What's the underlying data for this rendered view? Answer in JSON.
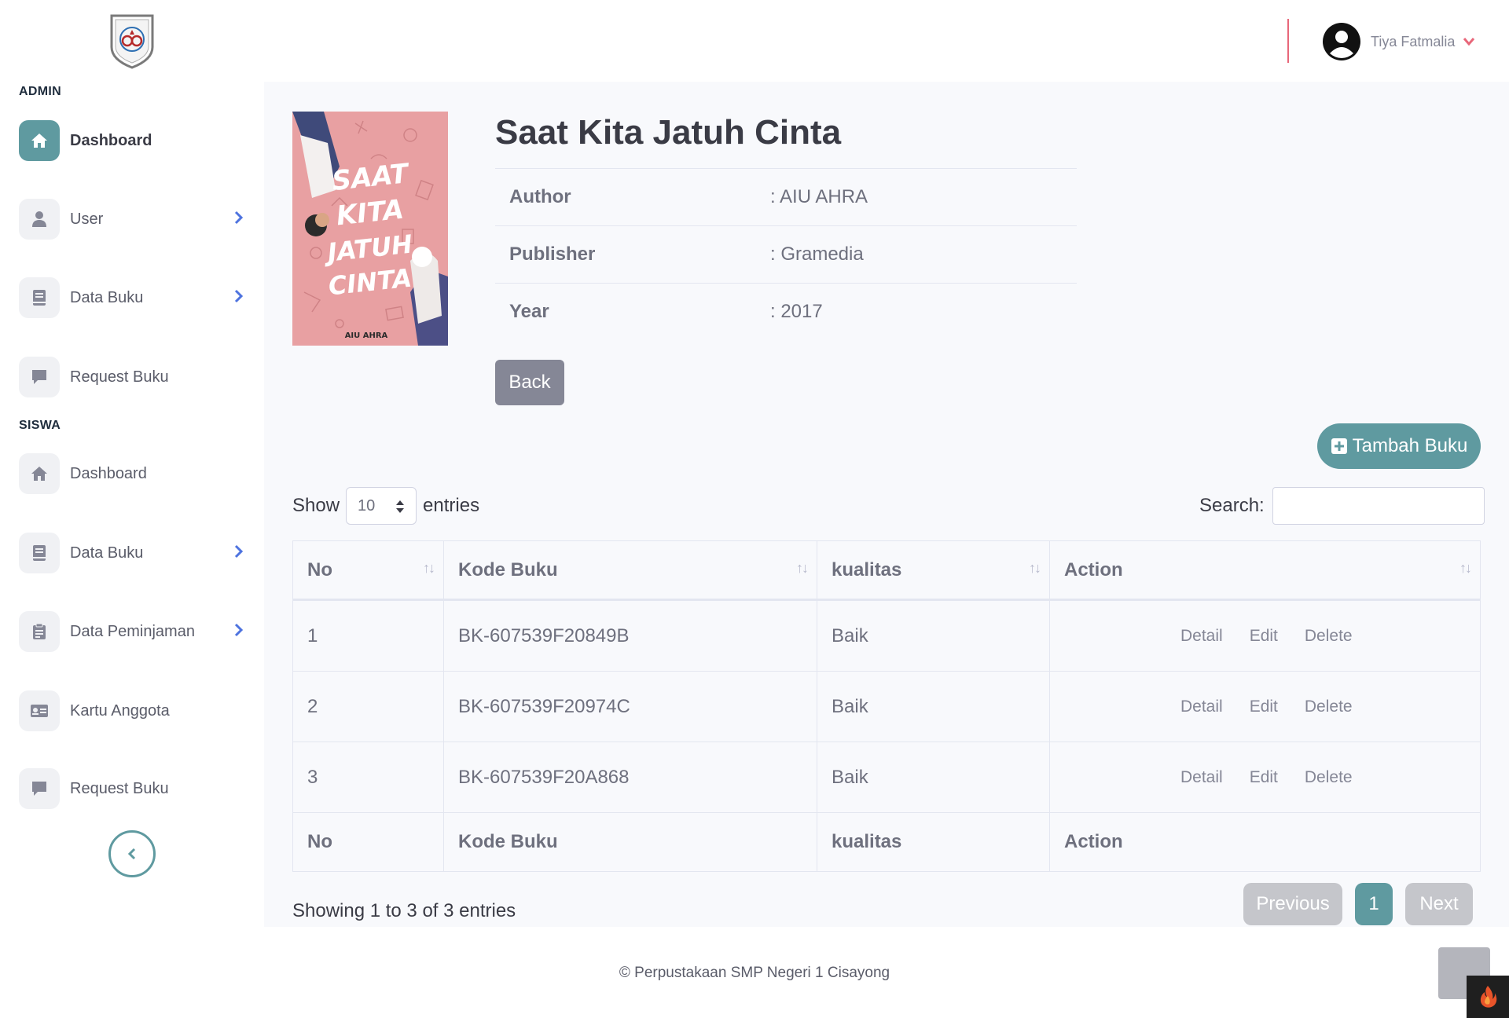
{
  "sidebar": {
    "admin_heading": "ADMIN",
    "siswa_heading": "SISWA",
    "admin_items": [
      {
        "label": "Dashboard",
        "icon": "home-icon",
        "active": true
      },
      {
        "label": "User",
        "icon": "user-icon",
        "has_submenu": true
      },
      {
        "label": "Data Buku",
        "icon": "book-icon",
        "has_submenu": true
      },
      {
        "label": "Request Buku",
        "icon": "comment-icon"
      }
    ],
    "siswa_items": [
      {
        "label": "Dashboard",
        "icon": "home-icon"
      },
      {
        "label": "Data Buku",
        "icon": "book-icon",
        "has_submenu": true
      },
      {
        "label": "Data Peminjaman",
        "icon": "clipboard-icon",
        "has_submenu": true
      },
      {
        "label": "Kartu Anggota",
        "icon": "id-card-icon"
      },
      {
        "label": "Request Buku",
        "icon": "comment-icon"
      }
    ]
  },
  "topbar": {
    "user_name": "Tiya Fatmalia"
  },
  "book": {
    "title": "Saat Kita Jatuh Cinta",
    "cover_title_lines": [
      "SAAT",
      "KITA",
      "JATUH",
      "CINTA"
    ],
    "cover_author": "AIU AHRA",
    "details": [
      {
        "key": "Author",
        "value": ": AIU AHRA"
      },
      {
        "key": "Publisher",
        "value": ": Gramedia"
      },
      {
        "key": "Year",
        "value": ": 2017"
      }
    ],
    "back_label": "Back"
  },
  "toolbar": {
    "add_label": "Tambah Buku"
  },
  "table_controls": {
    "show_label": "Show",
    "entries_value": "10",
    "entries_label": "entries",
    "search_label": "Search:"
  },
  "table": {
    "columns": [
      "No",
      "Kode Buku",
      "kualitas",
      "Action"
    ],
    "rows": [
      {
        "no": "1",
        "kode": "BK-607539F20849B",
        "kualitas": "Baik"
      },
      {
        "no": "2",
        "kode": "BK-607539F20974C",
        "kualitas": "Baik"
      },
      {
        "no": "3",
        "kode": "BK-607539F20A868",
        "kualitas": "Baik"
      }
    ],
    "actions": [
      "Detail",
      "Edit",
      "Delete"
    ]
  },
  "pagination": {
    "info": "Showing 1 to 3 of 3 entries",
    "previous": "Previous",
    "page": "1",
    "next": "Next"
  },
  "footer": {
    "text": "© Perpustakaan SMP Negeri 1 Cisayong"
  },
  "colors": {
    "accent": "#5f9aa0",
    "topbar_divider": "#e8677a",
    "chevron": "#4e73df",
    "cover_bg": "#e8a0a2"
  }
}
